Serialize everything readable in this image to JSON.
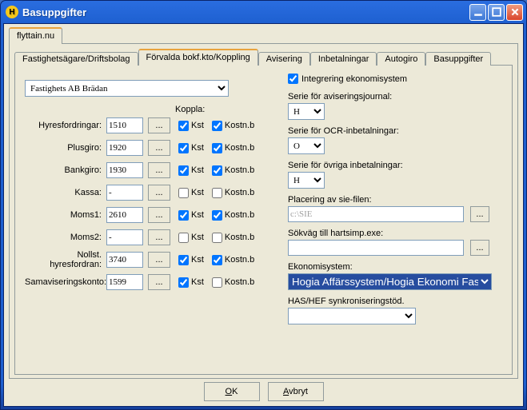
{
  "window": {
    "title": "Basuppgifter",
    "icon_letter": "H"
  },
  "tabs_outer": [
    {
      "label": "flyttain.nu",
      "active": true
    }
  ],
  "tabs_inner": [
    {
      "label": "Fastighetsägare/Driftsbolag",
      "active": false
    },
    {
      "label": "Förvalda bokf.kto/Koppling",
      "active": true
    },
    {
      "label": "Avisering",
      "active": false
    },
    {
      "label": "Inbetalningar",
      "active": false
    },
    {
      "label": "Autogiro",
      "active": false
    },
    {
      "label": "Basuppgifter",
      "active": false
    }
  ],
  "company_select": "Fastighets AB Brädan",
  "koppla_header": "Koppla:",
  "rows": [
    {
      "label": "Hyresfordringar:",
      "value": "1510",
      "kst": true,
      "kostnb": true
    },
    {
      "label": "Plusgiro:",
      "value": "1920",
      "kst": true,
      "kostnb": true
    },
    {
      "label": "Bankgiro:",
      "value": "1930",
      "kst": true,
      "kostnb": true
    },
    {
      "label": "Kassa:",
      "value": "-",
      "kst": false,
      "kostnb": false
    },
    {
      "label": "Moms1:",
      "value": "2610",
      "kst": true,
      "kostnb": true
    },
    {
      "label": "Moms2:",
      "value": "-",
      "kst": false,
      "kostnb": false
    },
    {
      "label": "Nollst. hyresfordran:",
      "value": "3740",
      "kst": true,
      "kostnb": true
    },
    {
      "label": "Samaviseringskonto:",
      "value": "1599",
      "kst": true,
      "kostnb": false
    }
  ],
  "kst_label": "Kst",
  "kostnb_label": "Kostn.b",
  "browse_label": "...",
  "integ": {
    "label": "Integrering ekonomisystem",
    "checked": true
  },
  "serie_avis": {
    "label": "Serie för aviseringsjournal:",
    "value": "H"
  },
  "serie_ocr": {
    "label": "Serie för OCR-inbetalningar:",
    "value": "O"
  },
  "serie_ovr": {
    "label": "Serie för övriga inbetalningar:",
    "value": "H"
  },
  "placering": {
    "label": "Placering av sie-filen:",
    "value": "c:\\SIE"
  },
  "sokvag": {
    "label": "Sökväg till hartsimp.exe:",
    "value": ""
  },
  "eco": {
    "label": "Ekonomisystem:",
    "value": "Hogia Affärssystem/Hogia Ekonomi Fastighet"
  },
  "hashef": {
    "label": "HAS/HEF synkroniseringstöd.",
    "value": ""
  },
  "buttons": {
    "ok": "OK",
    "cancel": "Avbryt"
  }
}
